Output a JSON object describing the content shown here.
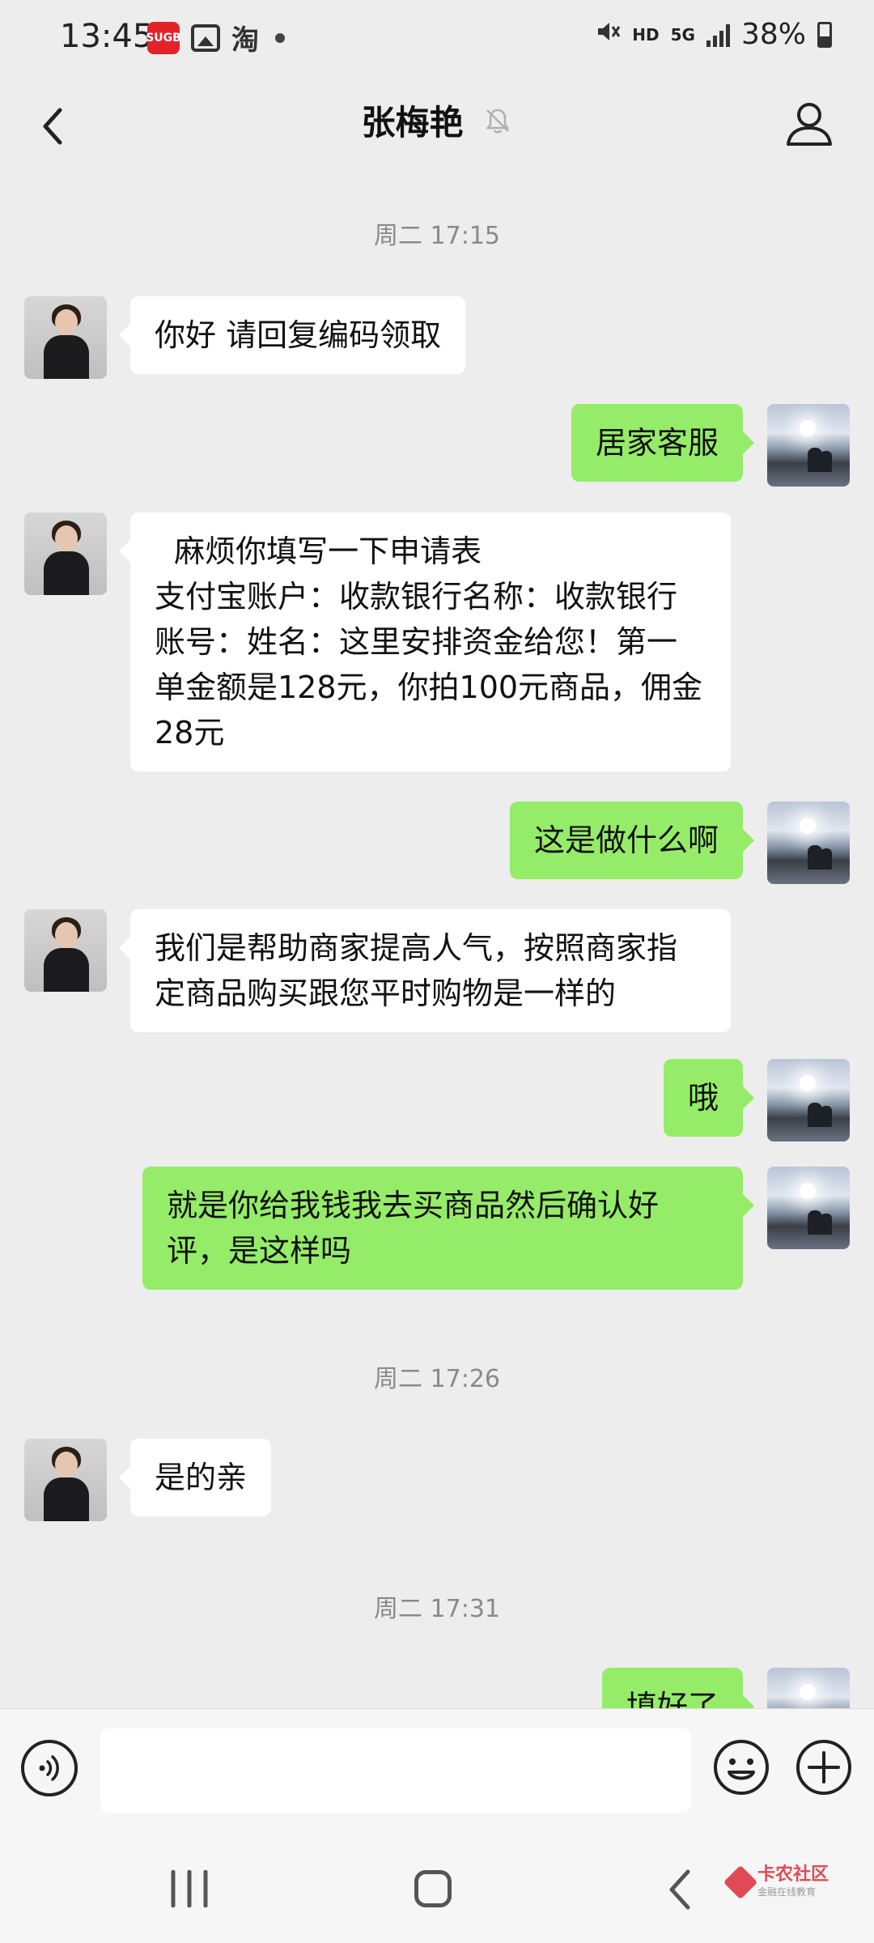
{
  "status_bar": {
    "time": "13:45",
    "app_badge": "SUGB",
    "taobao_glyph": "淘",
    "hd": "HD",
    "network": "5G",
    "battery": "38%"
  },
  "header": {
    "title": "张梅艳"
  },
  "chat": {
    "timestamps": [
      "周二 17:15",
      "周二 17:26",
      "周二 17:31"
    ],
    "messages": [
      {
        "side": "left",
        "text": "你好 请回复编码领取"
      },
      {
        "side": "right",
        "text": "居家客服"
      },
      {
        "side": "left",
        "text": "  麻烦你填写一下申请表\n支付宝账户：收款银行名称：收款银行账号：姓名：这里安排资金给您！第一单金额是128元，你拍100元商品，佣金28元"
      },
      {
        "side": "right",
        "text": "这是做什么啊"
      },
      {
        "side": "left",
        "text": "我们是帮助商家提高人气，按照商家指定商品购买跟您平时购物是一样的"
      },
      {
        "side": "right",
        "text": "哦"
      },
      {
        "side": "right",
        "text": "就是你给我钱我去买商品然后确认好评，是这样吗"
      },
      {
        "side": "left",
        "text": "是的亲"
      },
      {
        "side": "right",
        "text": "填好了"
      }
    ]
  },
  "input_bar": {
    "placeholder": ""
  },
  "watermark": {
    "text": "卡农社区",
    "sub": "金融在线教育"
  },
  "icons": {
    "back": "chevron-left-icon",
    "mute": "bell-off-icon",
    "profile": "person-icon",
    "voice": "voice-icon",
    "emoji": "smiley-icon",
    "add": "plus-circle-icon"
  },
  "colors": {
    "background": "#ededed",
    "bubble_self": "#95ec69",
    "bubble_other": "#ffffff"
  }
}
